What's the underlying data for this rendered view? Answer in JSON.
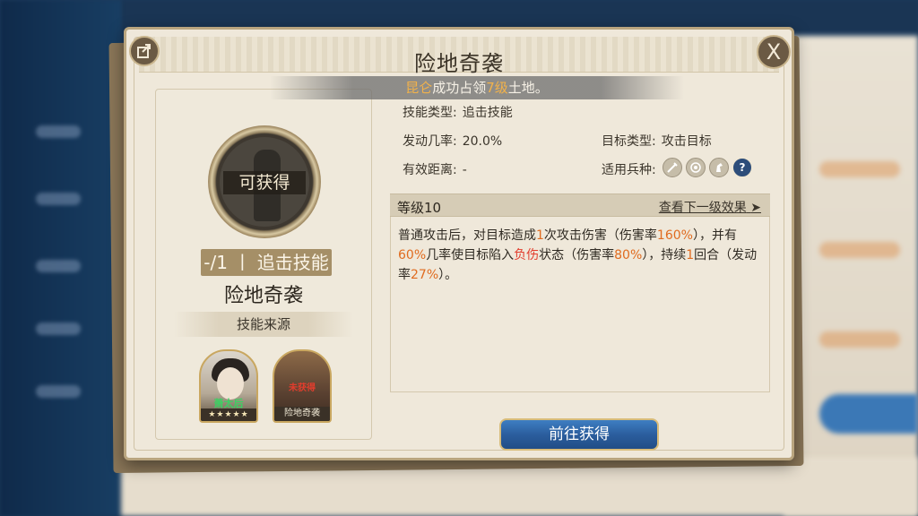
{
  "dialog": {
    "title": "险地奇袭",
    "share_icon": "share-icon",
    "close_icon": "close-icon",
    "close_glyph": "X"
  },
  "notice": {
    "player": "昆仑",
    "text_before_level": "成功占领",
    "level": "7级",
    "text_after": "土地。"
  },
  "skill_card": {
    "status_label": "可获得",
    "progress": "-/1",
    "divider": "丨",
    "skill_type": "追击技能",
    "name": "险地奇袭",
    "source_label": "技能来源"
  },
  "sources": [
    {
      "kind": "hero",
      "name": "萧太后",
      "stars": "★★★★★"
    },
    {
      "kind": "tactic",
      "tag": "未获得",
      "name": "险地奇袭"
    }
  ],
  "info": {
    "skill_type_label": "技能类型:",
    "skill_type_value": "追击技能",
    "trigger_rate_label": "发动几率:",
    "trigger_rate_value": "20.0%",
    "target_type_label": "目标类型:",
    "target_type_value": "攻击目标",
    "range_label": "有效距离:",
    "range_value": "-",
    "troop_label": "适用兵种:",
    "troop_icons": [
      "sword-icon",
      "bow-icon",
      "horse-icon",
      "question-icon"
    ],
    "question_glyph": "?"
  },
  "level": {
    "label": "等级10",
    "next_label": "查看下一级效果",
    "arrow": "➤"
  },
  "description": {
    "p1": "普通攻击后，对目标造成",
    "n1": "1",
    "p2": "次攻击伤害（伤害率",
    "n2": "160%",
    "p3": "），并有",
    "n3": "60%",
    "p4": "几率使目标陷入",
    "debuff": "负伤",
    "p5": "状态（伤害率",
    "n4": "80%",
    "p6": "），持续",
    "n5": "1",
    "p7": "回合（发动率",
    "n6": "27%",
    "p8": "）。"
  },
  "go_button": "前往获得",
  "colors": {
    "accent_orange": "#e06b1f",
    "debuff_red": "#e23d2d",
    "button_blue": "#2b5e9e",
    "panel_bg": "#efe8da"
  }
}
